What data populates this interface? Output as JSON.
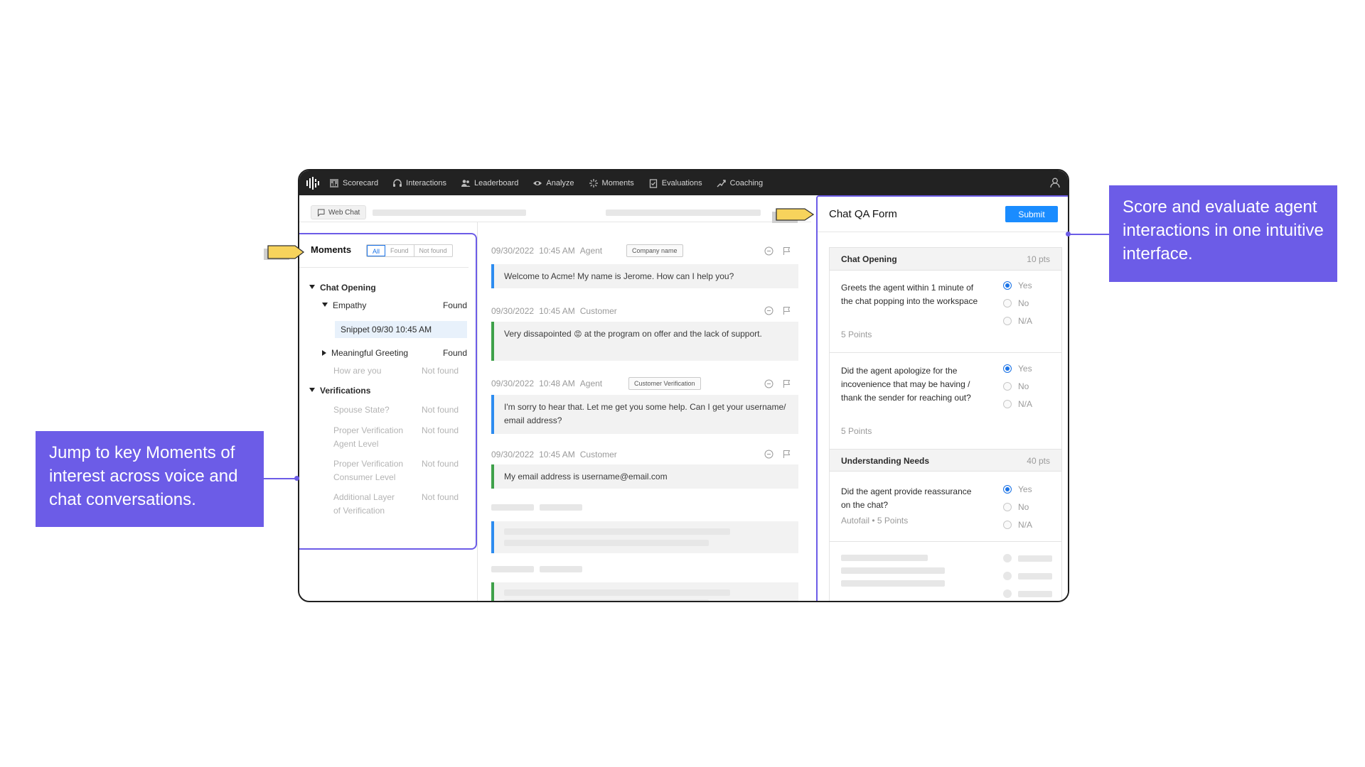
{
  "nav": {
    "items": [
      {
        "label": "Scorecard",
        "icon": "bar-chart-icon"
      },
      {
        "label": "Interactions",
        "icon": "headset-icon"
      },
      {
        "label": "Leaderboard",
        "icon": "people-icon"
      },
      {
        "label": "Analyze",
        "icon": "eye-icon"
      },
      {
        "label": "Moments",
        "icon": "sparkle-icon"
      },
      {
        "label": "Evaluations",
        "icon": "clipboard-check-icon"
      },
      {
        "label": "Coaching",
        "icon": "trend-icon"
      }
    ]
  },
  "subheader": {
    "channel_label": "Web Chat"
  },
  "moments": {
    "title": "Moments",
    "filters": [
      "All",
      "Found",
      "Not found"
    ],
    "active_filter": "All",
    "tree": {
      "chat_opening": "Chat Opening",
      "empathy": {
        "label": "Empathy",
        "status": "Found"
      },
      "snippet": "Snippet 09/30 10:45 AM",
      "meaningful_greeting": {
        "label": "Meaningful Greeting",
        "status": "Found"
      },
      "how_are_you": {
        "label": "How are you",
        "status": "Not found"
      },
      "verifications": "Verifications",
      "spouse_state": {
        "label": "Spouse State?",
        "status": "Not found"
      },
      "proper_agent": {
        "label_line1": "Proper Verification",
        "label_line2": "Agent Level",
        "status": "Not found"
      },
      "proper_consumer": {
        "label_line1": "Proper Verification",
        "label_line2": "Consumer Level",
        "status": "Not found"
      },
      "additional_layer": {
        "label_line1": "Additional Layer",
        "label_line2": "of Verification",
        "status": "Not found"
      }
    }
  },
  "chat": {
    "messages": [
      {
        "date": "09/30/2022",
        "time": "10:45 AM",
        "role": "Agent",
        "tag": "Company name",
        "text": "Welcome to Acme! My name is Jerome. How can I help you?"
      },
      {
        "date": "09/30/2022",
        "time": "10:45 AM",
        "role": "Customer",
        "tag": "",
        "text_before": "Very dissapointed",
        "emoji": "😡",
        "text_after": "at the program on offer and the lack of support."
      },
      {
        "date": "09/30/2022",
        "time": "10:48 AM",
        "role": "Agent",
        "tag": "Customer Verification",
        "text": "I'm sorry to hear that. Let me get you some help. Can I get your username/ email address?"
      },
      {
        "date": "09/30/2022",
        "time": "10:45 AM",
        "role": "Customer",
        "tag": "",
        "text": "My email address is username@email.com"
      }
    ]
  },
  "qa_form": {
    "title": "Chat QA Form",
    "submit_label": "Submit",
    "sections": [
      {
        "name": "Chat Opening",
        "points": "10 pts"
      },
      {
        "name": "Understanding Needs",
        "points": "40 pts"
      }
    ],
    "questions": [
      {
        "text": "Greets the agent within 1 minute of the chat popping into the workspace",
        "points": "5 Points",
        "selected": "Yes"
      },
      {
        "text": "Did the agent apologize for the incovenience that may be having / thank the sender for reaching out?",
        "points": "5 Points",
        "selected": "Yes"
      },
      {
        "text": "Did the agent provide reassurance on the chat?",
        "points": "Autofail • 5 Points",
        "selected": "Yes"
      }
    ],
    "options": [
      "Yes",
      "No",
      "N/A"
    ]
  },
  "annotations": {
    "left": "Jump to key Moments of interest across voice and chat conversations.",
    "right": "Score and evaluate agent interactions in one intuitive interface."
  },
  "colors": {
    "accent": "#6c5ce7",
    "primary_blue": "#1a8cff",
    "agent_bar": "#2d8cf0",
    "customer_bar": "#3fa14a",
    "pointer": "#f7d35c",
    "topbar": "#222222"
  }
}
